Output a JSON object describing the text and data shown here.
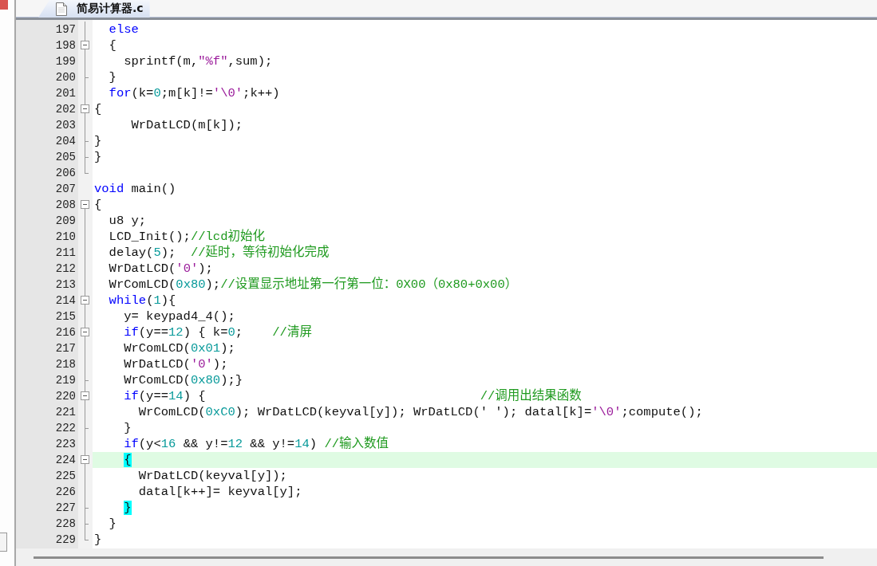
{
  "tabs": [
    {
      "title": "简易计算器.c",
      "selected": true
    }
  ],
  "lines": [
    {
      "number": "197",
      "kind": "line",
      "highlighted": false,
      "tokens": [
        {
          "kind": "keyword",
          "text": "  else"
        }
      ]
    },
    {
      "number": "198",
      "kind": "box",
      "highlighted": false,
      "tokens": [
        {
          "kind": "plain",
          "text": "  {"
        }
      ]
    },
    {
      "number": "199",
      "kind": "line",
      "highlighted": false,
      "tokens": [
        {
          "kind": "plain",
          "text": "    sprintf(m,"
        },
        {
          "kind": "string",
          "text": "\"%f\""
        },
        {
          "kind": "plain",
          "text": ",sum);"
        }
      ]
    },
    {
      "number": "200",
      "kind": "tick",
      "highlighted": false,
      "tokens": [
        {
          "kind": "plain",
          "text": "  }"
        }
      ]
    },
    {
      "number": "201",
      "kind": "line",
      "highlighted": false,
      "tokens": [
        {
          "kind": "keyword",
          "text": "  for"
        },
        {
          "kind": "plain",
          "text": "(k="
        },
        {
          "kind": "number",
          "text": "0"
        },
        {
          "kind": "plain",
          "text": ";m[k]!="
        },
        {
          "kind": "string",
          "text": "'\\0'"
        },
        {
          "kind": "plain",
          "text": ";k++)"
        }
      ]
    },
    {
      "number": "202",
      "kind": "box",
      "highlighted": false,
      "tokens": [
        {
          "kind": "plain",
          "text": "{"
        }
      ]
    },
    {
      "number": "203",
      "kind": "line",
      "highlighted": false,
      "tokens": [
        {
          "kind": "plain",
          "text": "     WrDatLCD(m[k]);"
        }
      ]
    },
    {
      "number": "204",
      "kind": "tick",
      "highlighted": false,
      "tokens": [
        {
          "kind": "plain",
          "text": "}"
        }
      ]
    },
    {
      "number": "205",
      "kind": "tick",
      "highlighted": false,
      "tokens": [
        {
          "kind": "plain",
          "text": "}"
        }
      ]
    },
    {
      "number": "206",
      "kind": "end",
      "highlighted": false
    },
    {
      "number": "207",
      "kind": "none",
      "highlighted": false,
      "tokens": [
        {
          "kind": "keyword",
          "text": "void"
        },
        {
          "kind": "plain",
          "text": " main()"
        }
      ]
    },
    {
      "number": "208",
      "kind": "box",
      "highlighted": false,
      "tokens": [
        {
          "kind": "plain",
          "text": "{"
        }
      ]
    },
    {
      "number": "209",
      "kind": "line",
      "highlighted": false,
      "tokens": [
        {
          "kind": "plain",
          "text": "  u8 y;"
        }
      ]
    },
    {
      "number": "210",
      "kind": "line",
      "highlighted": false,
      "tokens": [
        {
          "kind": "plain",
          "text": "  LCD_Init();"
        },
        {
          "kind": "comment",
          "text": "//lcd初始化"
        }
      ]
    },
    {
      "number": "211",
      "kind": "line",
      "highlighted": false,
      "tokens": [
        {
          "kind": "plain",
          "text": "  delay("
        },
        {
          "kind": "number",
          "text": "5"
        },
        {
          "kind": "plain",
          "text": ");  "
        },
        {
          "kind": "comment",
          "text": "//延时，等待初始化完成"
        }
      ]
    },
    {
      "number": "212",
      "kind": "line",
      "highlighted": false,
      "tokens": [
        {
          "kind": "plain",
          "text": "  WrDatLCD("
        },
        {
          "kind": "string",
          "text": "'0'"
        },
        {
          "kind": "plain",
          "text": ");"
        }
      ]
    },
    {
      "number": "213",
      "kind": "line",
      "highlighted": false,
      "tokens": [
        {
          "kind": "plain",
          "text": "  WrComLCD("
        },
        {
          "kind": "number",
          "text": "0x80"
        },
        {
          "kind": "plain",
          "text": ");"
        },
        {
          "kind": "comment",
          "text": "//设置显示地址第一行第一位：0X00（0x80+0x00）"
        }
      ]
    },
    {
      "number": "214",
      "kind": "box",
      "highlighted": false,
      "tokens": [
        {
          "kind": "keyword",
          "text": "  while"
        },
        {
          "kind": "plain",
          "text": "("
        },
        {
          "kind": "number",
          "text": "1"
        },
        {
          "kind": "plain",
          "text": "){"
        }
      ]
    },
    {
      "number": "215",
      "kind": "line",
      "highlighted": false,
      "tokens": [
        {
          "kind": "plain",
          "text": "    y= keypad4_4();"
        }
      ]
    },
    {
      "number": "216",
      "kind": "box",
      "highlighted": false,
      "tokens": [
        {
          "kind": "keyword",
          "text": "    if"
        },
        {
          "kind": "plain",
          "text": "(y=="
        },
        {
          "kind": "number",
          "text": "12"
        },
        {
          "kind": "plain",
          "text": ") { k="
        },
        {
          "kind": "number",
          "text": "0"
        },
        {
          "kind": "plain",
          "text": ";    "
        },
        {
          "kind": "comment",
          "text": "//清屏"
        }
      ]
    },
    {
      "number": "217",
      "kind": "line",
      "highlighted": false,
      "tokens": [
        {
          "kind": "plain",
          "text": "    WrComLCD("
        },
        {
          "kind": "number",
          "text": "0x01"
        },
        {
          "kind": "plain",
          "text": ");"
        }
      ]
    },
    {
      "number": "218",
      "kind": "line",
      "highlighted": false,
      "tokens": [
        {
          "kind": "plain",
          "text": "    WrDatLCD("
        },
        {
          "kind": "string",
          "text": "'0'"
        },
        {
          "kind": "plain",
          "text": ");"
        }
      ]
    },
    {
      "number": "219",
      "kind": "tick",
      "highlighted": false,
      "tokens": [
        {
          "kind": "plain",
          "text": "    WrComLCD("
        },
        {
          "kind": "number",
          "text": "0x80"
        },
        {
          "kind": "plain",
          "text": ");}"
        }
      ]
    },
    {
      "number": "220",
      "kind": "box",
      "highlighted": false,
      "tokens": [
        {
          "kind": "keyword",
          "text": "    if"
        },
        {
          "kind": "plain",
          "text": "(y=="
        },
        {
          "kind": "number",
          "text": "14"
        },
        {
          "kind": "plain",
          "text": ") {                                     "
        },
        {
          "kind": "comment",
          "text": "//调用出结果函数"
        }
      ]
    },
    {
      "number": "221",
      "kind": "line",
      "highlighted": false,
      "tokens": [
        {
          "kind": "plain",
          "text": "      WrComLCD("
        },
        {
          "kind": "number",
          "text": "0xC0"
        },
        {
          "kind": "plain",
          "text": "); WrDatLCD(keyval[y]); WrDatLCD(' '); datal[k]="
        },
        {
          "kind": "string",
          "text": "'\\0'"
        },
        {
          "kind": "plain",
          "text": ";compute();"
        }
      ]
    },
    {
      "number": "222",
      "kind": "tick",
      "highlighted": false,
      "tokens": [
        {
          "kind": "plain",
          "text": "    }"
        }
      ]
    },
    {
      "number": "223",
      "kind": "line",
      "highlighted": false,
      "tokens": [
        {
          "kind": "keyword",
          "text": "    if"
        },
        {
          "kind": "plain",
          "text": "(y<"
        },
        {
          "kind": "number",
          "text": "16"
        },
        {
          "kind": "plain",
          "text": " && y!="
        },
        {
          "kind": "number",
          "text": "12"
        },
        {
          "kind": "plain",
          "text": " && y!="
        },
        {
          "kind": "number",
          "text": "14"
        },
        {
          "kind": "plain",
          "text": ") "
        },
        {
          "kind": "comment",
          "text": "//输入数值"
        }
      ]
    },
    {
      "number": "224",
      "kind": "box",
      "highlighted": true,
      "tokens": [
        {
          "kind": "match",
          "text": "    {"
        }
      ]
    },
    {
      "number": "225",
      "kind": "line",
      "highlighted": false,
      "tokens": [
        {
          "kind": "plain",
          "text": "      WrDatLCD(keyval[y]);"
        }
      ]
    },
    {
      "number": "226",
      "kind": "line",
      "highlighted": false,
      "tokens": [
        {
          "kind": "plain",
          "text": "      datal[k++]= keyval[y];"
        }
      ]
    },
    {
      "number": "227",
      "kind": "tick",
      "highlighted": false,
      "tokens": [
        {
          "kind": "match",
          "text": "    }"
        }
      ]
    },
    {
      "number": "228",
      "kind": "tick",
      "highlighted": false,
      "tokens": [
        {
          "kind": "plain",
          "text": "  }"
        }
      ]
    },
    {
      "number": "229",
      "kind": "end",
      "highlighted": false,
      "tokens": [
        {
          "kind": "plain",
          "text": "}"
        }
      ]
    }
  ]
}
